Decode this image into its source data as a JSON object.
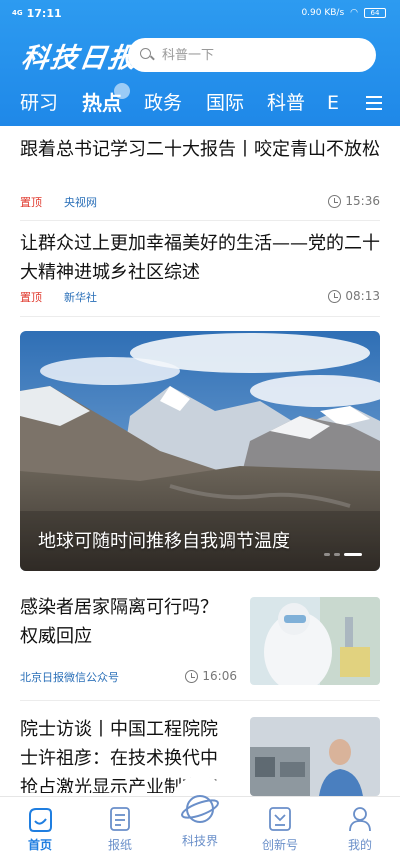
{
  "status_bar": {
    "time": "17:11",
    "network": "4G",
    "speed": "0.90 KB/s",
    "battery": "64"
  },
  "header": {
    "logo": "科技日报",
    "search_placeholder": "科普一下"
  },
  "tabs": [
    {
      "label": "研习"
    },
    {
      "label": "热点",
      "active": true
    },
    {
      "label": "政务"
    },
    {
      "label": "国际"
    },
    {
      "label": "科普"
    },
    {
      "label": "E"
    }
  ],
  "news": [
    {
      "title": "跟着总书记学习二十大报告丨咬定青山不放松",
      "tag": "置顶",
      "source": "央视网",
      "time": "15:36"
    },
    {
      "title": "让群众过上更加幸福美好的生活——党的二十大精神进城乡社区综述",
      "tag": "置顶",
      "source": "新华社",
      "time": "08:13"
    }
  ],
  "hero": {
    "caption": "地球可随时间推移自我调节温度",
    "slide_count": 3,
    "active_slide": 3
  },
  "thumb_news": [
    {
      "title": "感染者居家隔离可行吗？权威回应",
      "source": "北京日报微信公众号",
      "time": "16:06"
    },
    {
      "title": "院士访谈丨中国工程院院士许祖彦：在技术换代中抢占激光显示产业制高点"
    }
  ],
  "bottom_nav": [
    {
      "label": "首页",
      "icon": "home-icon",
      "active": true
    },
    {
      "label": "报纸",
      "icon": "newspaper-icon"
    },
    {
      "label": "科技界",
      "icon": "planet-icon"
    },
    {
      "label": "创新号",
      "icon": "innovation-icon"
    },
    {
      "label": "我的",
      "icon": "profile-icon"
    }
  ],
  "colors": {
    "brand_blue": "#1f88e8",
    "pin_red": "#e03a2e",
    "source_blue": "#2a6fb8"
  }
}
